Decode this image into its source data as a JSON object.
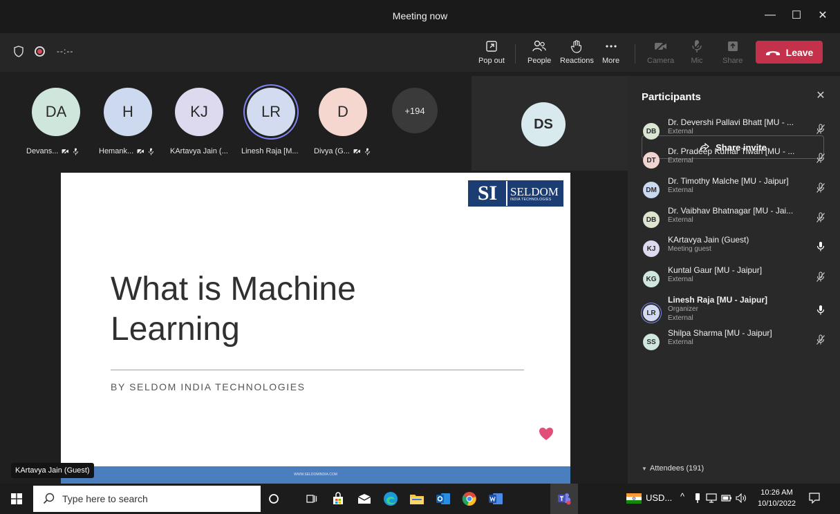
{
  "window": {
    "title": "Meeting now",
    "minimize": "—",
    "maximize": "☐",
    "close": "✕"
  },
  "toolbar": {
    "timer": "--:--",
    "popout": "Pop out",
    "people": "People",
    "reactions": "Reactions",
    "more": "More",
    "camera": "Camera",
    "mic": "Mic",
    "share": "Share",
    "leave": "Leave"
  },
  "gallery": {
    "tiles": [
      {
        "initials": "DA",
        "name": "Devans...",
        "color": "#cfe6dc"
      },
      {
        "initials": "H",
        "name": "Hemank...",
        "color": "#cdd9ef"
      },
      {
        "initials": "KJ",
        "name": "KArtavya Jain (...",
        "color": "#ddd9ee"
      },
      {
        "initials": "LR",
        "name": "Linesh Raja [M...",
        "color": "#d3dbf0"
      },
      {
        "initials": "D",
        "name": "Divya (G...",
        "color": "#f6d7cf"
      }
    ],
    "overflow": "+194",
    "spotlight": {
      "initials": "DS",
      "color": "#d8eaee"
    }
  },
  "slide": {
    "logo_mark": "SI",
    "logo_name": "SELDOM",
    "logo_sub": "INDIA TECHNOLOGIES",
    "title_line1": "What is Machine",
    "title_line2": "Learning",
    "subtitle": "BY SELDOM INDIA TECHNOLOGIES",
    "footer_url": "WWW.SELDOMINDIA.COM"
  },
  "speaker_badge": "KArtavya Jain (Guest)",
  "panel": {
    "title": "Participants",
    "share_invite": "Share invite",
    "participants": [
      {
        "initials": "DB",
        "name": "Dr. Devershi Pallavi Bhatt [MU - ...",
        "role": "External",
        "role2": "",
        "mic": "muted",
        "color": "#d9e7d2"
      },
      {
        "initials": "DT",
        "name": "Dr. Pradeep Kumar Tiwari [MU - ...",
        "role": "External",
        "role2": "",
        "mic": "muted",
        "color": "#f1d4d0"
      },
      {
        "initials": "DM",
        "name": "Dr. Timothy Malche [MU - Jaipur]",
        "role": "External",
        "role2": "",
        "mic": "muted",
        "color": "#c9d9f1"
      },
      {
        "initials": "DB",
        "name": "Dr. Vaibhav Bhatnagar [MU - Jai...",
        "role": "External",
        "role2": "",
        "mic": "muted",
        "color": "#dde5cf"
      },
      {
        "initials": "KJ",
        "name": "KArtavya Jain (Guest)",
        "role": "Meeting guest",
        "role2": "",
        "mic": "on",
        "color": "#ddd9ee"
      },
      {
        "initials": "KG",
        "name": "Kuntal Gaur [MU - Jaipur]",
        "role": "External",
        "role2": "",
        "mic": "muted",
        "color": "#cfe7df"
      },
      {
        "initials": "LR",
        "name": "Linesh Raja [MU - Jaipur]",
        "role": "Organizer",
        "role2": "External",
        "mic": "on",
        "color": "#d3dbf0"
      },
      {
        "initials": "SS",
        "name": "Shilpa Sharma [MU - Jaipur]",
        "role": "External",
        "role2": "",
        "mic": "muted",
        "color": "#cfe7df"
      }
    ],
    "attendees": "Attendees (191)"
  },
  "taskbar": {
    "search_placeholder": "Type here to search",
    "currency": "USD...",
    "time": "10:26 AM",
    "date": "10/10/2022"
  },
  "colors": {
    "accent": "#7f85f5",
    "leave": "#c4314b",
    "slide_bar": "#4a7ebf",
    "logo": "#1b3d73"
  }
}
